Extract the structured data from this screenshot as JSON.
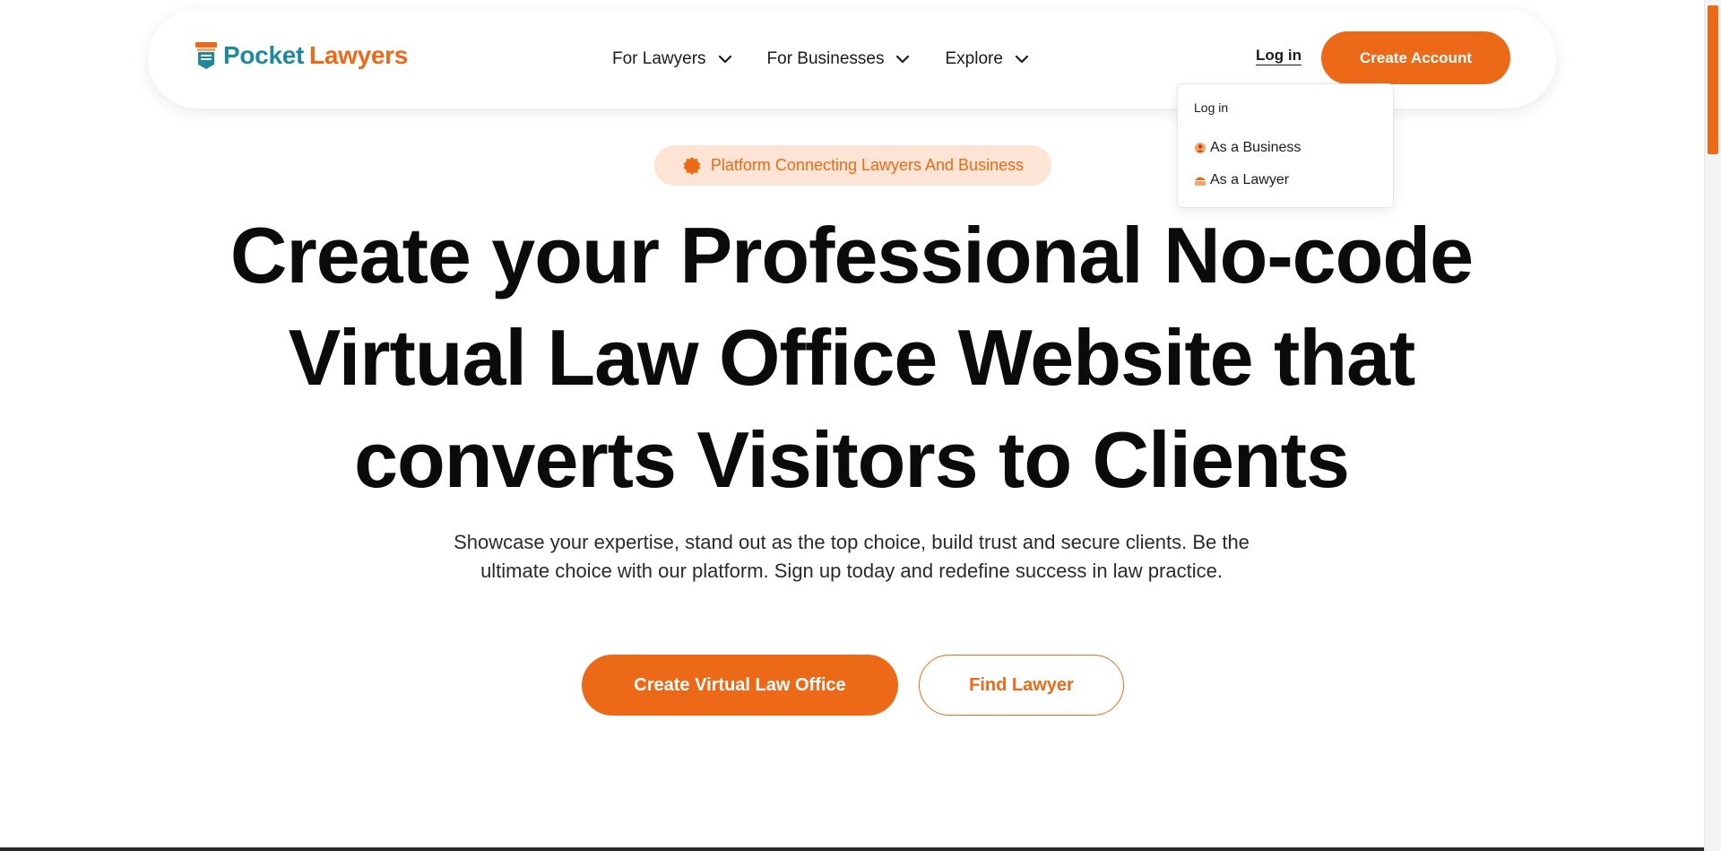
{
  "header": {
    "logo": {
      "word1": "Pocket",
      "word2": "Lawyers",
      "icon": "book-stack-icon"
    },
    "nav": [
      {
        "label": "For Lawyers",
        "icon": "chevron-down-icon"
      },
      {
        "label": "For Businesses",
        "icon": "chevron-down-icon"
      },
      {
        "label": "Explore",
        "icon": "chevron-down-icon"
      }
    ],
    "login_label": "Log in",
    "create_account_label": "Create Account"
  },
  "login_dropdown": {
    "title": "Log in",
    "items": [
      {
        "label": "As a Business",
        "icon": "business-icon"
      },
      {
        "label": "As a Lawyer",
        "icon": "lawyer-icon"
      }
    ]
  },
  "hero": {
    "badge": {
      "label": "Platform Connecting Lawyers And Business",
      "icon": "badge-seal-icon"
    },
    "title_lines": [
      "Create your Professional No-code",
      "Virtual Law Office Website that",
      "converts Visitors to Clients"
    ],
    "subtitle": "Showcase your expertise, stand out as the top choice, build trust and secure clients. Be the ultimate choice with our platform. Sign up today and redefine success in law practice.",
    "primary_cta": "Create Virtual Law Office",
    "secondary_cta": "Find Lawyer"
  },
  "colors": {
    "accent": "#ec6a17",
    "brand_teal": "#21899c",
    "badge_bg": "#fde4d4",
    "text": "#0b0b0b"
  }
}
